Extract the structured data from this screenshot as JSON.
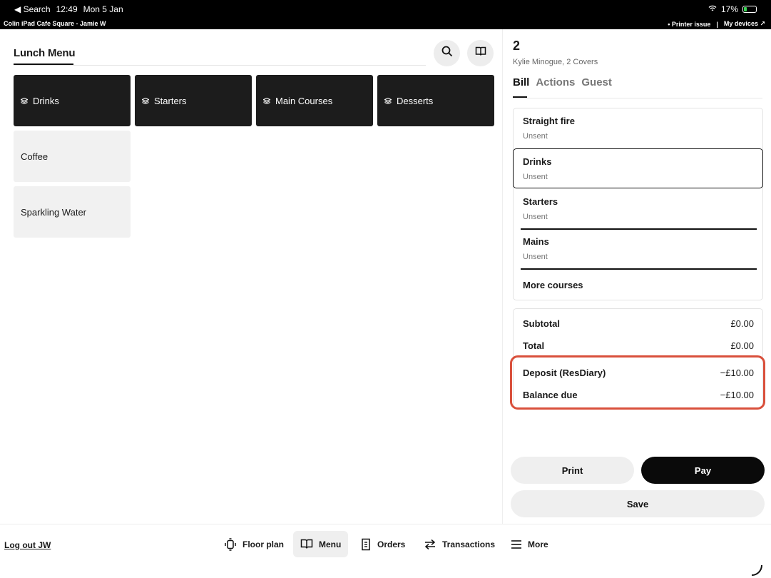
{
  "status_bar": {
    "back_label": "◀ Search",
    "time": "12:49",
    "date": "Mon 5 Jan",
    "battery": "17%",
    "device_name": "Colin iPad Cafe Square - Jamie W",
    "printer_issue": "Printer issue",
    "my_devices": "My devices ↗"
  },
  "menu": {
    "tab_label": "Lunch Menu",
    "categories": [
      {
        "label": "Drinks"
      },
      {
        "label": "Starters"
      },
      {
        "label": "Main Courses"
      },
      {
        "label": "Desserts"
      }
    ],
    "items": [
      {
        "label": "Coffee"
      },
      {
        "label": "Sparkling Water"
      }
    ]
  },
  "bill": {
    "table_number": "2",
    "guest_summary": "Kylie Minogue, 2 Covers",
    "tabs": [
      "Bill",
      "Actions",
      "Guest"
    ],
    "courses": [
      {
        "name": "Straight fire",
        "status": "Unsent"
      },
      {
        "name": "Drinks",
        "status": "Unsent"
      },
      {
        "name": "Starters",
        "status": "Unsent"
      },
      {
        "name": "Mains",
        "status": "Unsent"
      }
    ],
    "more_courses": "More courses",
    "totals": {
      "subtotal_label": "Subtotal",
      "subtotal": "£0.00",
      "total_label": "Total",
      "total": "£0.00",
      "deposit_label": "Deposit (ResDiary)",
      "deposit": "−£10.00",
      "balance_label": "Balance due",
      "balance": "−£10.00"
    },
    "print_label": "Print",
    "pay_label": "Pay",
    "save_label": "Save"
  },
  "nav": {
    "logout": "Log out JW",
    "items": [
      "Floor plan",
      "Menu",
      "Orders",
      "Transactions",
      "More"
    ]
  },
  "colors": {
    "highlight": "#d9503c",
    "tile_dark": "#1c1c1c",
    "tile_light": "#f1f1f1"
  }
}
